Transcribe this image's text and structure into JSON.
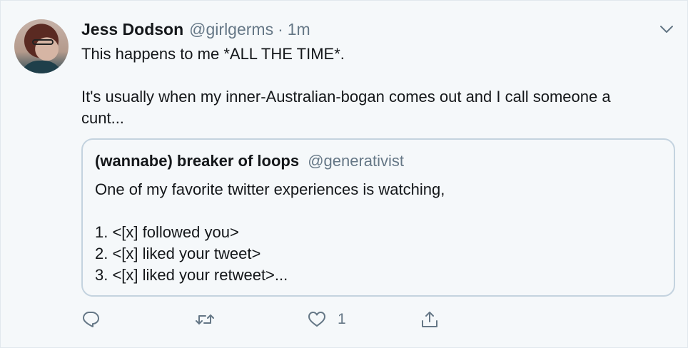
{
  "tweet": {
    "author_name": "Jess Dodson",
    "author_handle": "@girlgerms",
    "separator": "·",
    "time": "1m",
    "text": "This happens to me *ALL THE TIME*.\n\nIt's usually when my inner-Australian-bogan comes out and I call someone a cunt...",
    "avatar_icon": "user-avatar",
    "menu_icon": "chevron-down-icon"
  },
  "quoted_tweet": {
    "author_name": "(wannabe) breaker of loops",
    "author_handle": "@generativist",
    "text": "One of my favorite twitter experiences is watching,\n\n1. <[x] followed you>\n2. <[x] liked your tweet>\n3. <[x] liked your retweet>..."
  },
  "actions": {
    "reply_icon": "reply-icon",
    "retweet_icon": "retweet-icon",
    "like_icon": "heart-icon",
    "like_count": "1",
    "share_icon": "share-icon"
  },
  "colors": {
    "background": "#f5f8fa",
    "secondary_text": "#657786",
    "border": "#c4d3df"
  }
}
